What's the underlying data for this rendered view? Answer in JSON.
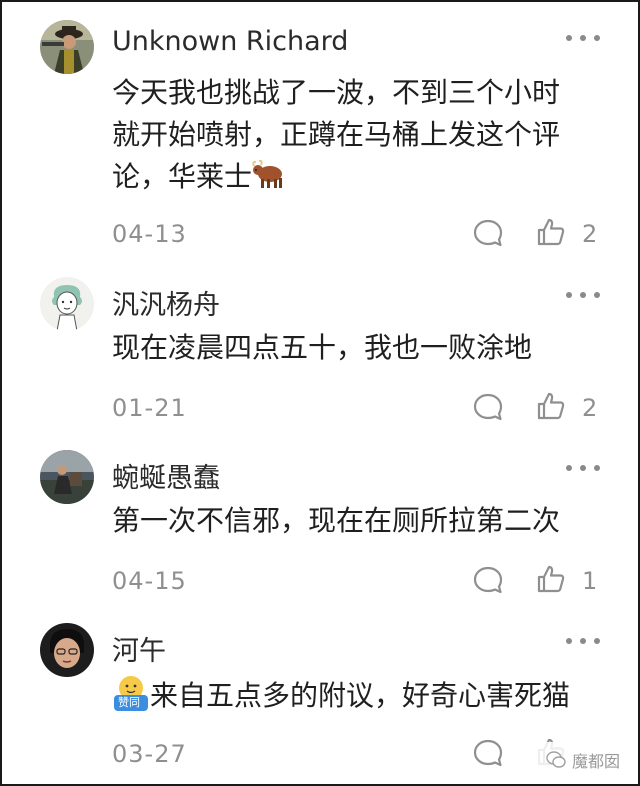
{
  "comments": [
    {
      "username": "Unknown Richard",
      "text_line1": "今天我也挑战了一波，不到三个小时",
      "text_line2": "就开始喷射，正蹲在马桶上发这个评",
      "text_line3": "论，华莱士",
      "emoji": "🐂",
      "date": "04-13",
      "likes": "2"
    },
    {
      "username": "汎汎杨舟",
      "text": "现在凌晨四点五十，我也一败涂地",
      "date": "01-21",
      "likes": "2"
    },
    {
      "username": "蜿蜒愚蠢",
      "text": "第一次不信邪，现在在厕所拉第二次",
      "date": "04-15",
      "likes": "1"
    },
    {
      "username": "河午",
      "badge_text": "赞同",
      "text": "来自五点多的附议，好奇心害死猫",
      "date": "03-27",
      "likes": ""
    }
  ],
  "watermark": "魔都囡",
  "icons": {
    "more": "more-dots-icon",
    "reply": "speech-bubble-icon",
    "like": "thumbs-up-icon"
  },
  "colors": {
    "text": "#1f1f1f",
    "meta": "#8f8f8f",
    "border": "#1a1a1a"
  }
}
